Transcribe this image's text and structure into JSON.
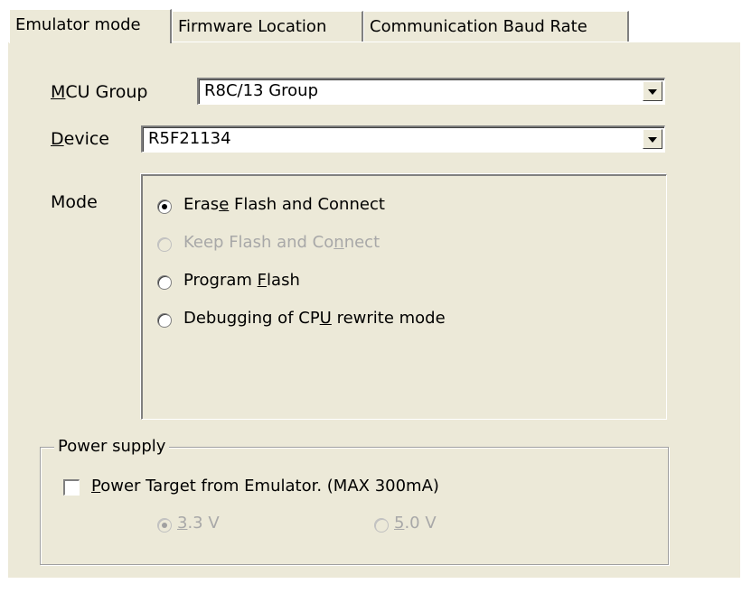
{
  "tabs": [
    {
      "label": "Emulator mode",
      "active": true
    },
    {
      "label": "Firmware Location",
      "active": false
    },
    {
      "label": "Communication Baud Rate",
      "active": false
    }
  ],
  "mcu_group": {
    "label_access": "M",
    "label_rest": "CU Group",
    "value": "R8C/13 Group"
  },
  "device": {
    "label_access": "D",
    "label_rest": "evice",
    "value": "R5F21134"
  },
  "mode": {
    "label": "Mode",
    "options": [
      {
        "pre": "Eras",
        "access": "e",
        "post": " Flash and Connect",
        "selected": true,
        "enabled": true
      },
      {
        "pre": "Keep Flash and Co",
        "access": "n",
        "post": "nect",
        "selected": false,
        "enabled": false
      },
      {
        "pre": "Program ",
        "access": "F",
        "post": "lash",
        "selected": false,
        "enabled": true
      },
      {
        "pre": "Debugging of CP",
        "access": "U",
        "post": " rewrite mode",
        "selected": false,
        "enabled": true
      }
    ]
  },
  "power": {
    "group_label": "Power supply",
    "check_access": "P",
    "check_rest": "ower Target from Emulator. (MAX 300mA)",
    "checked": false,
    "voltages": [
      {
        "access": "3",
        "rest": ".3 V",
        "selected": true,
        "enabled": false
      },
      {
        "access": "5",
        "rest": ".0 V",
        "selected": false,
        "enabled": false
      }
    ]
  },
  "colors": {
    "face": "#ece9d8",
    "shadow": "#808080",
    "disabled_text": "#a8a8a8"
  }
}
